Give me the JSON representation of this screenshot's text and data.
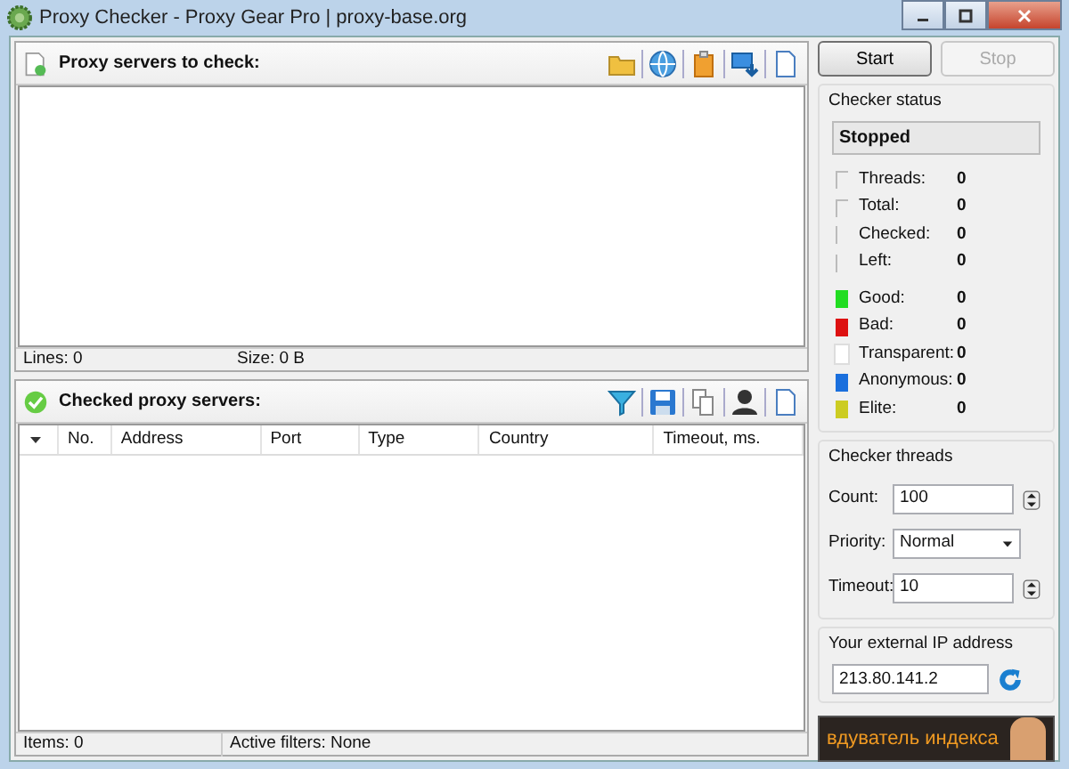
{
  "window": {
    "title": "Proxy Checker - Proxy Gear Pro | proxy-base.org"
  },
  "input_panel": {
    "title": "Proxy servers to check:",
    "status": [
      "Lines: 0",
      "Size: 0 B"
    ]
  },
  "results_panel": {
    "title": "Checked proxy servers:",
    "columns": [
      "No.",
      "Address",
      "Port",
      "Type",
      "Country",
      "Timeout, ms."
    ],
    "status": [
      "Items: 0",
      "Active filters: None"
    ]
  },
  "buttons": [
    {
      "label": "Start",
      "disabled": false
    },
    {
      "label": "Stop",
      "disabled": true
    }
  ],
  "checker_status": {
    "title": "Checker status",
    "state": "Stopped",
    "rows": [
      {
        "kind": "counter",
        "label": "Threads:",
        "value": "0"
      },
      {
        "kind": "counter",
        "label": "Total:",
        "value": "0"
      },
      {
        "kind": "counter",
        "label": "Checked:",
        "value": "0"
      },
      {
        "kind": "counter",
        "label": "Left:",
        "value": "0"
      },
      {
        "kind": "legend",
        "label": "Good:",
        "value": "0",
        "color": "#22dd22"
      },
      {
        "kind": "legend",
        "label": "Bad:",
        "value": "0",
        "color": "#dd1111"
      },
      {
        "kind": "legend",
        "label": "Transparent:",
        "value": "0",
        "color": "#ffffff"
      },
      {
        "kind": "legend",
        "label": "Anonymous:",
        "value": "0",
        "color": "#1a6fdd"
      },
      {
        "kind": "legend",
        "label": "Elite:",
        "value": "0",
        "color": "#cccc22"
      }
    ]
  },
  "checker_threads": {
    "title": "Checker threads",
    "fields": [
      {
        "kind": "spin",
        "label": "Count:",
        "value": "100"
      },
      {
        "kind": "select",
        "label": "Priority:",
        "value": "Normal"
      },
      {
        "kind": "spin",
        "label": "Timeout:",
        "value": "10"
      }
    ]
  },
  "external_ip": {
    "title": "Your external IP address",
    "value": "213.80.141.2"
  },
  "banner": {
    "text": "вдуватель индекса"
  }
}
